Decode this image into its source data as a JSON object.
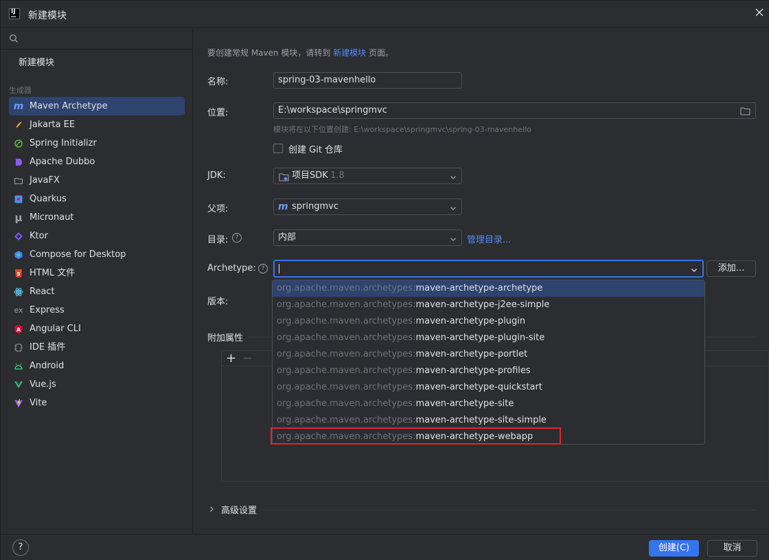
{
  "window": {
    "title": "新建模块"
  },
  "sidebar": {
    "search_placeholder": "",
    "new_module": "新建模块",
    "section_label": "生成器",
    "items": [
      {
        "label": "Maven Archetype",
        "icon": "maven-icon",
        "selected": true
      },
      {
        "label": "Jakarta EE",
        "icon": "jakarta-ee-icon"
      },
      {
        "label": "Spring Initializr",
        "icon": "spring-icon"
      },
      {
        "label": "Apache Dubbo",
        "icon": "dubbo-icon"
      },
      {
        "label": "JavaFX",
        "icon": "javafx-icon"
      },
      {
        "label": "Quarkus",
        "icon": "quarkus-icon"
      },
      {
        "label": "Micronaut",
        "icon": "micronaut-icon"
      },
      {
        "label": "Ktor",
        "icon": "ktor-icon"
      },
      {
        "label": "Compose for Desktop",
        "icon": "compose-icon"
      },
      {
        "label": "HTML 文件",
        "icon": "html-icon"
      },
      {
        "label": "React",
        "icon": "react-icon"
      },
      {
        "label": "Express",
        "icon": "express-icon"
      },
      {
        "label": "Angular CLI",
        "icon": "angular-icon"
      },
      {
        "label": "IDE 插件",
        "icon": "ide-plugin-icon"
      },
      {
        "label": "Android",
        "icon": "android-icon"
      },
      {
        "label": "Vue.js",
        "icon": "vue-icon"
      },
      {
        "label": "Vite",
        "icon": "vite-icon"
      }
    ]
  },
  "main": {
    "hint_prefix": "要创建常规 Maven 模块，请转到 ",
    "hint_link": "新建模块",
    "hint_suffix": " 页面。",
    "name_label": "名称:",
    "name_value": "spring-03-mavenhello",
    "location_label": "位置:",
    "location_value": "E:\\workspace\\springmvc",
    "location_hint": "模块将在以下位置创建: E:\\workspace\\springmvc\\spring-03-mavenhello",
    "git_label": "创建 Git 仓库",
    "jdk_label": "JDK:",
    "jdk_value": "项目SDK",
    "jdk_version": "1.8",
    "parent_label": "父项:",
    "parent_value": "springmvc",
    "catalog_label": "目录:",
    "catalog_value": "内部",
    "catalog_link": "管理目录...",
    "archetype_label": "Archetype:",
    "archetype_value": "",
    "add_button": "添加...",
    "version_label": "版本:",
    "props_label": "附加属性",
    "props_add": "+",
    "props_remove": "−",
    "advanced_label": "高级设置"
  },
  "archetype_options": [
    {
      "group": "org.apache.maven.archetypes:",
      "artifact": "maven-archetype-archetype"
    },
    {
      "group": "org.apache.maven.archetypes:",
      "artifact": "maven-archetype-j2ee-simple"
    },
    {
      "group": "org.apache.maven.archetypes:",
      "artifact": "maven-archetype-plugin"
    },
    {
      "group": "org.apache.maven.archetypes:",
      "artifact": "maven-archetype-plugin-site"
    },
    {
      "group": "org.apache.maven.archetypes:",
      "artifact": "maven-archetype-portlet"
    },
    {
      "group": "org.apache.maven.archetypes:",
      "artifact": "maven-archetype-profiles"
    },
    {
      "group": "org.apache.maven.archetypes:",
      "artifact": "maven-archetype-quickstart"
    },
    {
      "group": "org.apache.maven.archetypes:",
      "artifact": "maven-archetype-site"
    },
    {
      "group": "org.apache.maven.archetypes:",
      "artifact": "maven-archetype-site-simple"
    },
    {
      "group": "org.apache.maven.archetypes:",
      "artifact": "maven-archetype-webapp"
    }
  ],
  "footer": {
    "help": "?",
    "create_button": "创建(C)",
    "cancel_button": "取消"
  },
  "colors": {
    "background": "#2b2d30",
    "accent": "#3574f0",
    "link": "#548af7",
    "selection": "#2e436e",
    "highlight_border": "#e0262b"
  }
}
